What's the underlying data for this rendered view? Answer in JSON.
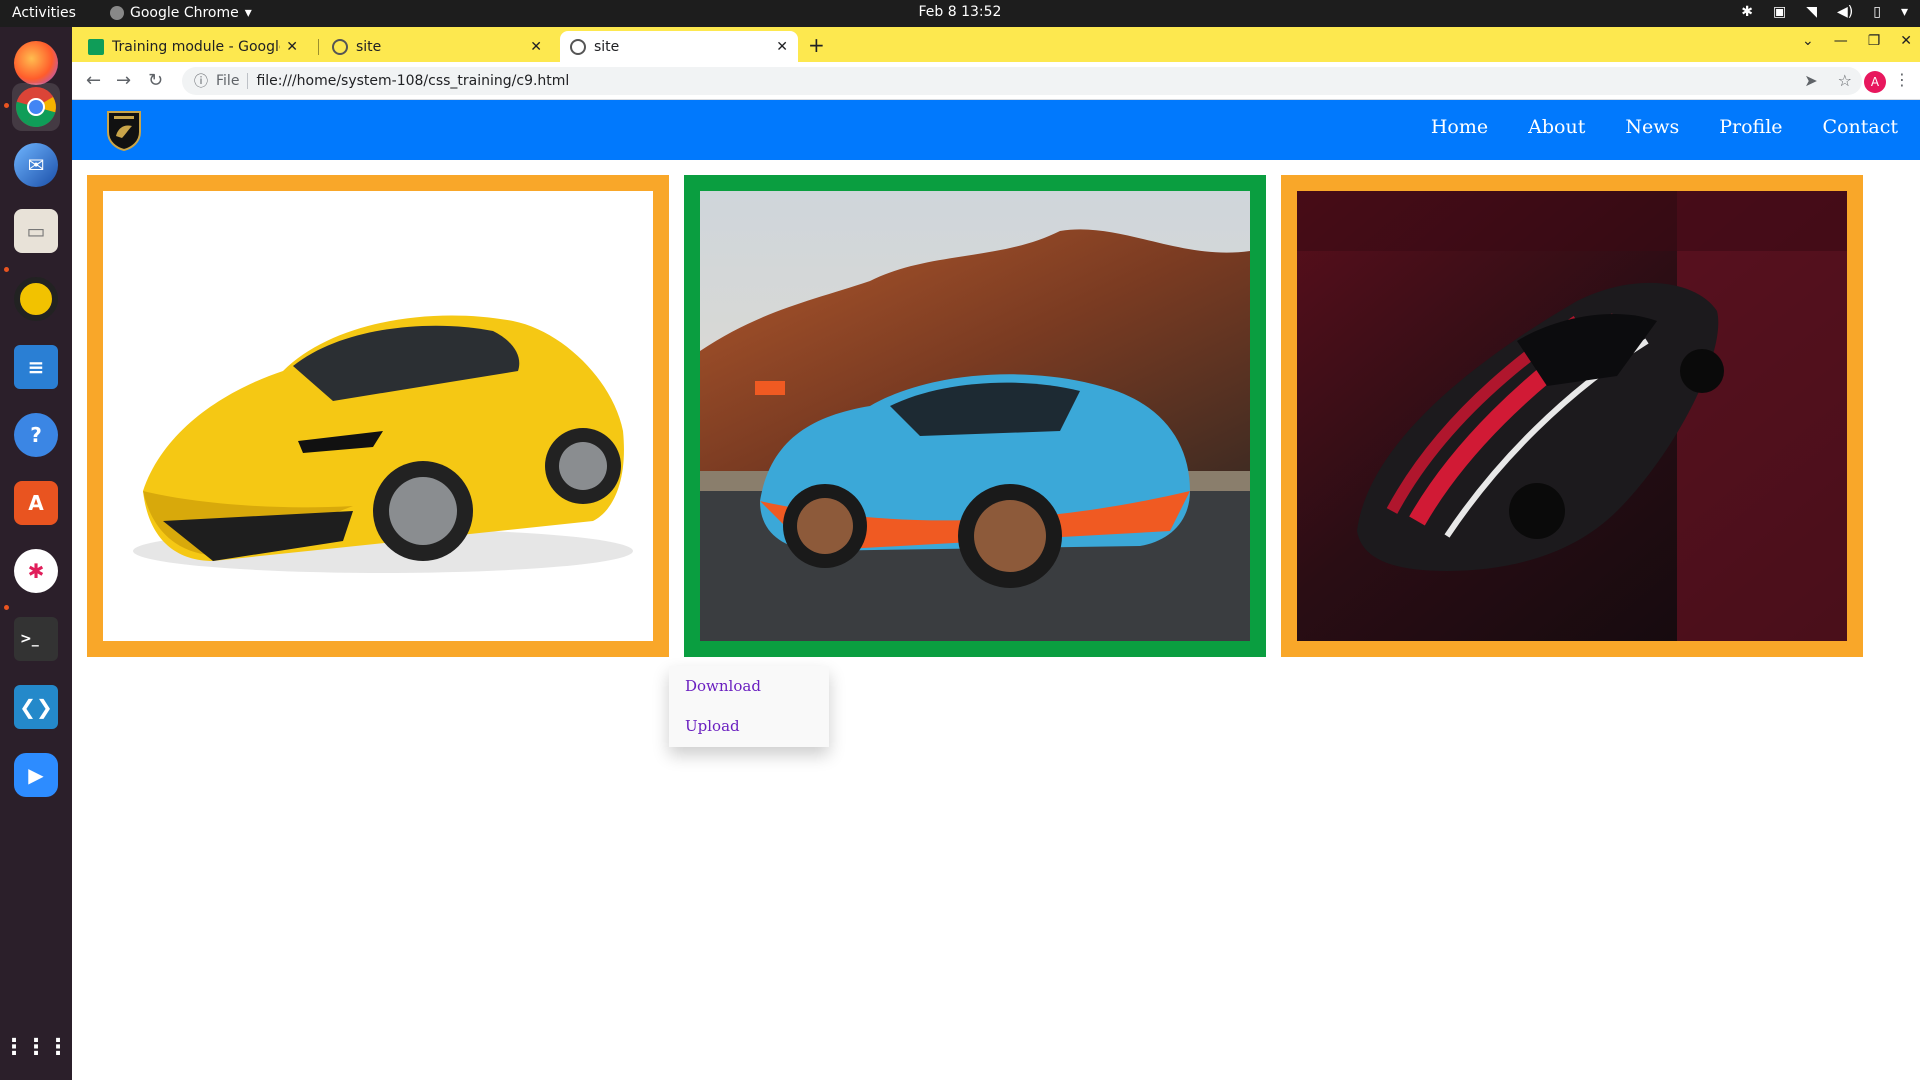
{
  "system": {
    "activities": "Activities",
    "app_name": "Google Chrome",
    "clock": "Feb 8  13:52"
  },
  "browser": {
    "tabs": [
      {
        "title": "Training module - Google",
        "active": false
      },
      {
        "title": "site",
        "active": false
      },
      {
        "title": "site",
        "active": true
      }
    ],
    "omnibox": {
      "scheme_label": "File",
      "url": "file:///home/system-108/css_training/c9.html"
    },
    "avatar_letter": "A",
    "accent_color": "#fde84f"
  },
  "site": {
    "navbar_color": "#0179fd",
    "nav_links": [
      "Home",
      "About",
      "News",
      "Profile",
      "Contact"
    ],
    "cards": [
      {
        "image": "yellow-lamborghini-huracan",
        "border_color": "#f9a729"
      },
      {
        "image": "blue-lamborghini-huracan-sto",
        "border_color": "#0a9e40"
      },
      {
        "image": "red-black-lamborghini-aventador",
        "border_color": "#f9a729"
      }
    ],
    "dropdown": {
      "items": [
        "Download",
        "Upload"
      ]
    }
  },
  "dock": {
    "apps": [
      "firefox",
      "chrome",
      "thunderbird",
      "files",
      "rhythmbox",
      "writer",
      "help",
      "software",
      "slack",
      "terminal",
      "vscode",
      "zoom",
      "app-grid"
    ]
  }
}
